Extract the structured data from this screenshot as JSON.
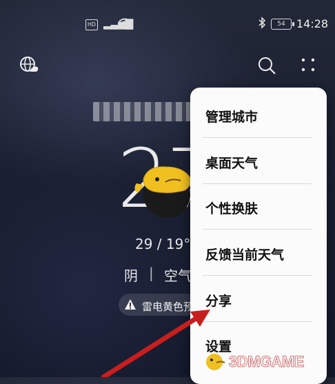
{
  "status_bar": {
    "hd_badge": "HD",
    "battery": "54",
    "time": "14:28"
  },
  "weather": {
    "temperature": "27",
    "range": "29 / 19°",
    "condition": "阴",
    "separator": "|",
    "air": "空气",
    "alert": "雷电黄色预"
  },
  "menu": {
    "items": [
      {
        "label": "管理城市"
      },
      {
        "label": "桌面天气"
      },
      {
        "label": "个性换肤"
      },
      {
        "label": "反馈当前天气"
      },
      {
        "label": "分享"
      },
      {
        "label": "设置"
      }
    ]
  },
  "watermark": {
    "text": "3DMGAME"
  },
  "colors": {
    "background": "#1b2032",
    "menu_bg": "#fbfbfb",
    "arrow": "#c81e1e",
    "mascot": "#f0c020"
  },
  "icons": [
    "globe-icon",
    "search-icon",
    "more-icon",
    "warning-icon",
    "signal-icon",
    "wifi-icon",
    "bluetooth-icon",
    "battery-icon"
  ]
}
